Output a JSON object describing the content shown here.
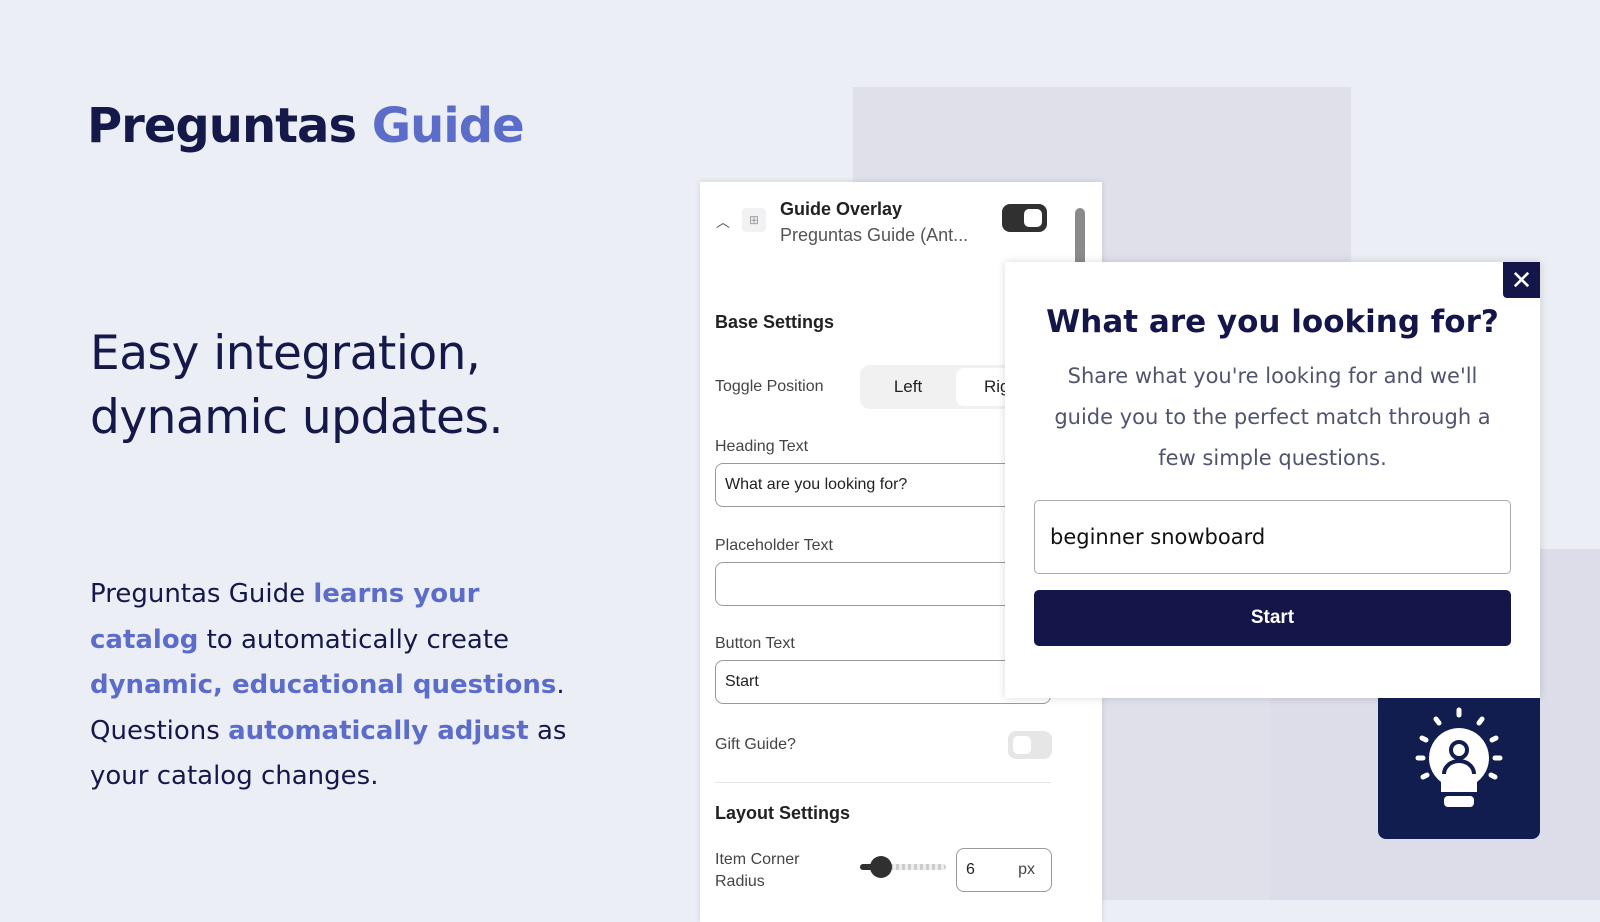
{
  "brand": {
    "name": "Preguntas",
    "accent": "Guide"
  },
  "tagline": [
    "Easy integration,",
    "dynamic updates."
  ],
  "description": [
    {
      "t": "Preguntas Guide ",
      "h": false
    },
    {
      "t": "learns your catalog",
      "h": true
    },
    {
      "t": " to automatically create ",
      "h": false
    },
    {
      "t": "dynamic, educational questions",
      "h": true
    },
    {
      "t": ". Questions ",
      "h": false
    },
    {
      "t": "automatically adjust",
      "h": true
    },
    {
      "t": " as your catalog changes.",
      "h": false
    }
  ],
  "panel": {
    "title": "Guide Overlay",
    "subtitle": "Preguntas Guide (Ant...",
    "enabled": true,
    "base_settings": "Base Settings",
    "toggle_position_label": "Toggle Position",
    "toggle_left": "Left",
    "toggle_right": "Rig",
    "heading_label": "Heading Text",
    "heading_value": "What are you looking for?",
    "placeholder_label": "Placeholder Text",
    "placeholder_value": "",
    "button_label": "Button Text",
    "button_value": "Start",
    "gift_label": "Gift Guide?",
    "gift_enabled": false,
    "layout_settings": "Layout Settings",
    "corner_label": "Item Corner Radius",
    "corner_value": "6",
    "corner_unit": "px"
  },
  "popup": {
    "title": "What are you looking for?",
    "description": "Share what you're looking for and we'll guide you to the perfect match through a few simple questions.",
    "input_value": "beginner snowboard",
    "button": "Start",
    "close": "✕"
  },
  "colors": {
    "navy": "#14164a",
    "accent": "#5b6cc9"
  },
  "icons": {
    "bulb": "lightbulb-person-icon"
  }
}
